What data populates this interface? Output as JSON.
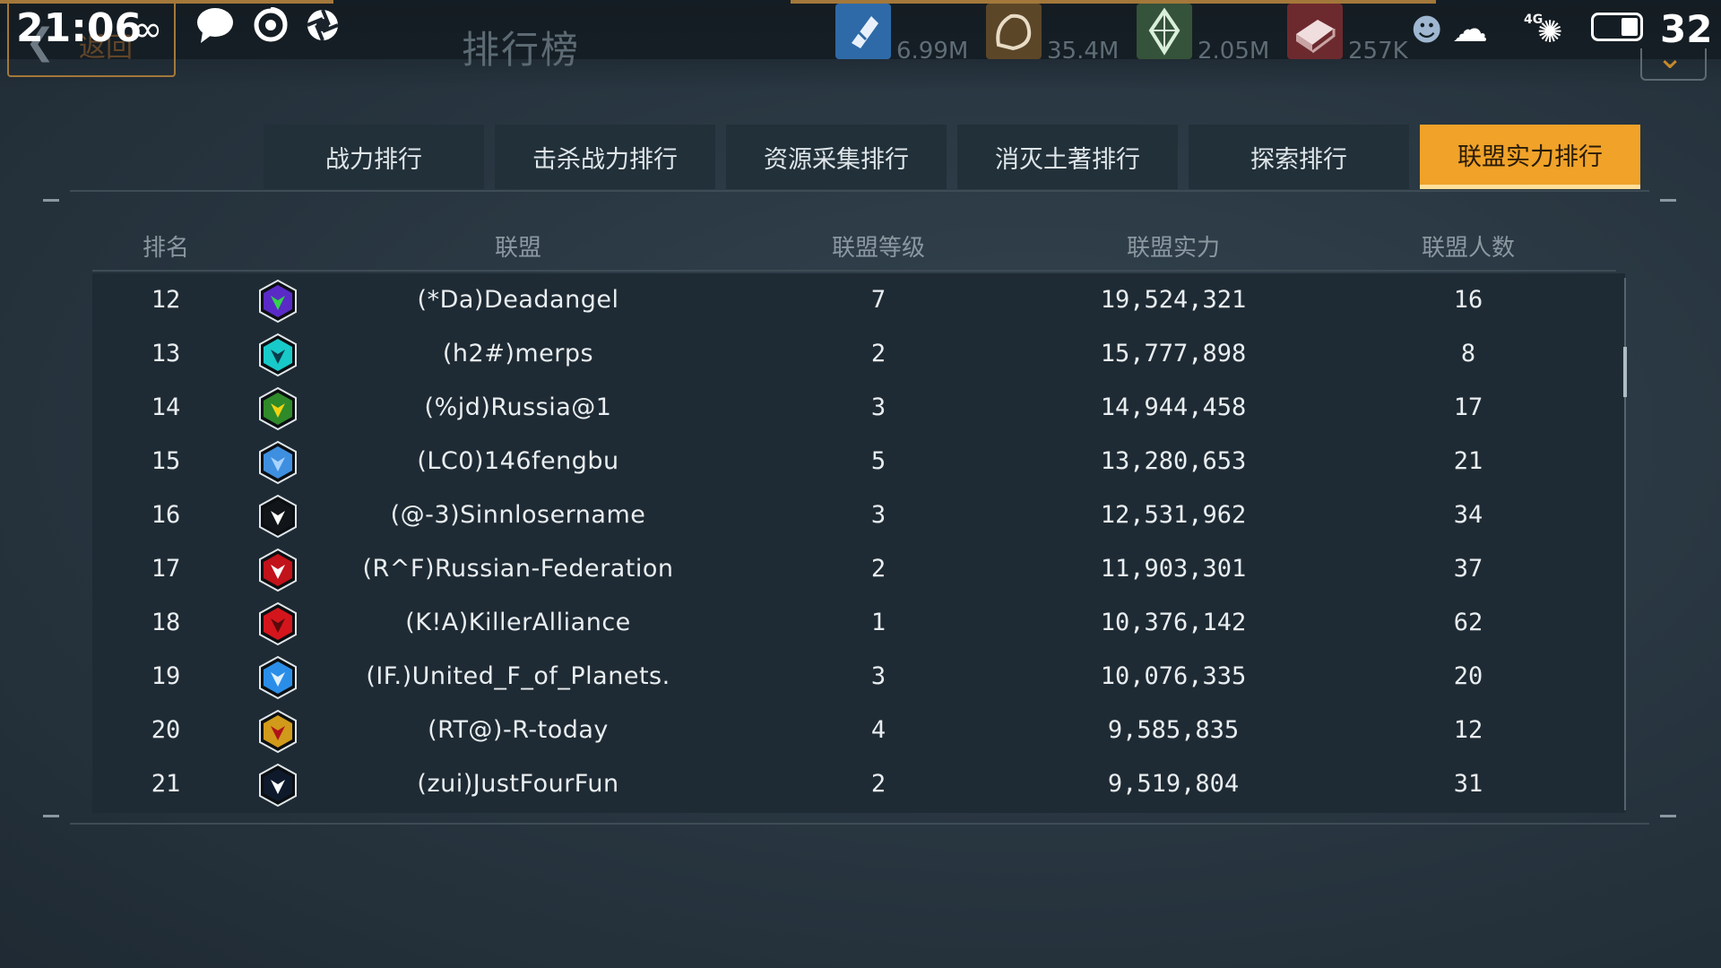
{
  "status_bar": {
    "time": "21:06",
    "network": "4G",
    "battery": "32"
  },
  "header": {
    "back_label": "返回",
    "title": "排行榜"
  },
  "resources": [
    {
      "name": "resource-1-icon",
      "value": "6.99M",
      "color": "#2e6aa8"
    },
    {
      "name": "resource-2-icon",
      "value": "35.4M",
      "color": "#6b5230"
    },
    {
      "name": "resource-3-icon",
      "value": "2.05M",
      "color": "#3b5a3f"
    },
    {
      "name": "resource-4-icon",
      "value": "257K",
      "color": "#7a2f33"
    }
  ],
  "tabs": [
    {
      "label": "战力排行",
      "active": false
    },
    {
      "label": "击杀战力排行",
      "active": false
    },
    {
      "label": "资源采集排行",
      "active": false
    },
    {
      "label": "消灭土著排行",
      "active": false
    },
    {
      "label": "探索排行",
      "active": false
    },
    {
      "label": "联盟实力排行",
      "active": true
    }
  ],
  "columns": {
    "rank": "排名",
    "alliance": "联盟",
    "level": "联盟等级",
    "power": "联盟实力",
    "members": "联盟人数"
  },
  "rows": [
    {
      "rank": "12",
      "name": "(*Da)Deadangel",
      "level": "7",
      "power": "19,524,321",
      "members": "16",
      "emblem": "green-wolf-emblem-icon",
      "emblem_bg": "#5a2ac6",
      "emblem_fg": "#32d44a"
    },
    {
      "rank": "13",
      "name": "(h2#)merps",
      "level": "2",
      "power": "15,777,898",
      "members": "8",
      "emblem": "cyan-cross-emblem-icon",
      "emblem_bg": "#18c9c9",
      "emblem_fg": "#0a3b4a"
    },
    {
      "rank": "14",
      "name": "(%jd)Russia@1",
      "level": "3",
      "power": "14,944,458",
      "members": "17",
      "emblem": "radiation-emblem-icon",
      "emblem_bg": "#2f8a2a",
      "emblem_fg": "#f2d312"
    },
    {
      "rank": "15",
      "name": "(LC0)146fengbu",
      "level": "5",
      "power": "13,280,653",
      "members": "21",
      "emblem": "blue-shield-emblem-icon",
      "emblem_bg": "#3f8fe0",
      "emblem_fg": "#a9d3ff"
    },
    {
      "rank": "16",
      "name": "(@-3)Sinnlosername",
      "level": "3",
      "power": "12,531,962",
      "members": "34",
      "emblem": "white-eagle-emblem-icon",
      "emblem_bg": "#111519",
      "emblem_fg": "#ffffff"
    },
    {
      "rank": "17",
      "name": "(R^F)Russian-Federation",
      "level": "2",
      "power": "11,903,301",
      "members": "37",
      "emblem": "red-star-emblem-icon",
      "emblem_bg": "#c2121a",
      "emblem_fg": "#ffffff"
    },
    {
      "rank": "18",
      "name": "(K!A)KillerAlliance",
      "level": "1",
      "power": "10,376,142",
      "members": "62",
      "emblem": "red-skull-emblem-icon",
      "emblem_bg": "#d4161c",
      "emblem_fg": "#5a0a0c"
    },
    {
      "rank": "19",
      "name": "(IF.)United_F_of_Planets.",
      "level": "3",
      "power": "10,076,335",
      "members": "20",
      "emblem": "blue-wings-emblem-icon",
      "emblem_bg": "#2a8ee8",
      "emblem_fg": "#dff0ff"
    },
    {
      "rank": "20",
      "name": "(RT@)-R-today",
      "level": "4",
      "power": "9,585,835",
      "members": "12",
      "emblem": "gold-red-emblem-icon",
      "emblem_bg": "#d19a1a",
      "emblem_fg": "#b0121a"
    },
    {
      "rank": "21",
      "name": "(zui)JustFourFun",
      "level": "2",
      "power": "9,519,804",
      "members": "31",
      "emblem": "dark-cube-emblem-icon",
      "emblem_bg": "#0e1a2c",
      "emblem_fg": "#ffffff"
    }
  ]
}
